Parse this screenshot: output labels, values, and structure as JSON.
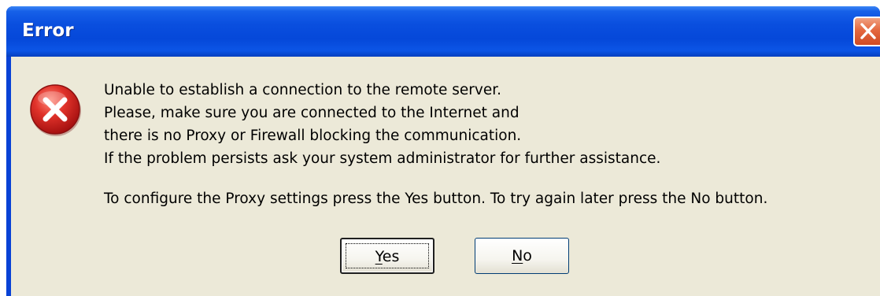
{
  "window": {
    "title": "Error"
  },
  "icons": {
    "dialog_icon": "error-x-icon",
    "close_icon": "close-icon"
  },
  "colors": {
    "titlebar": "#0a4fdf",
    "client_bg": "#ece9d8",
    "close_button": "#e4683f",
    "error_red": "#d01f1f"
  },
  "message": {
    "lines": [
      "Unable to establish a connection to the remote server.",
      "Please, make sure you are connected to the Internet and",
      "there is no Proxy or Firewall blocking the communication.",
      "If the problem persists ask your system administrator for further assistance."
    ],
    "instruction": "To configure the Proxy settings press the Yes button. To try again later press the No button."
  },
  "buttons": {
    "yes": {
      "mnemonic": "Y",
      "rest": "es"
    },
    "no": {
      "mnemonic": "N",
      "rest": "o"
    }
  }
}
